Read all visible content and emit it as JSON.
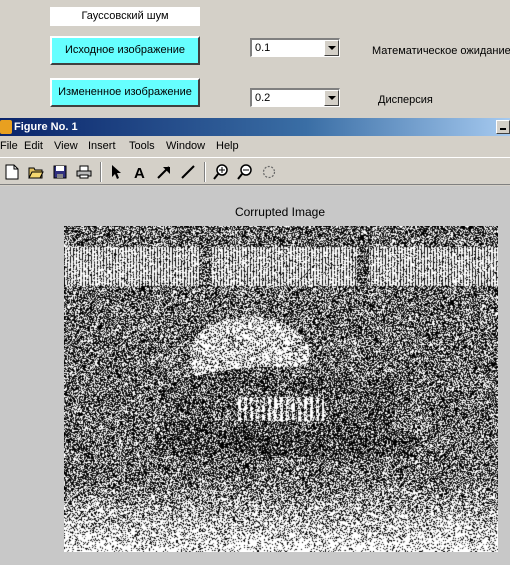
{
  "panel": {
    "noise_label": "Гауссовский шум",
    "original_button": "Исходное изображение",
    "modified_button": "Измененное изображение",
    "mean_value": "0.1",
    "variance_value": "0.2",
    "mean_label": "Математическое ожидание",
    "variance_label": "Дисперсия"
  },
  "window": {
    "title": "Figure No. 1"
  },
  "menu": {
    "items": [
      "File",
      "Edit",
      "View",
      "Insert",
      "Tools",
      "Window",
      "Help"
    ]
  },
  "toolbar": {
    "icons": [
      "new-file-icon",
      "open-folder-icon",
      "save-icon",
      "print-icon",
      "select-arrow-icon",
      "text-icon",
      "arrow-icon",
      "line-icon",
      "zoom-in-icon",
      "zoom-out-icon",
      "rotate-icon"
    ]
  },
  "figure": {
    "axes_title": "Corrupted Image"
  },
  "colors": {
    "button_bg": "#66ffff",
    "titlebar_start": "#0a246a",
    "window_bg": "#d4d0c8",
    "figure_bg": "#c8c8c8"
  }
}
